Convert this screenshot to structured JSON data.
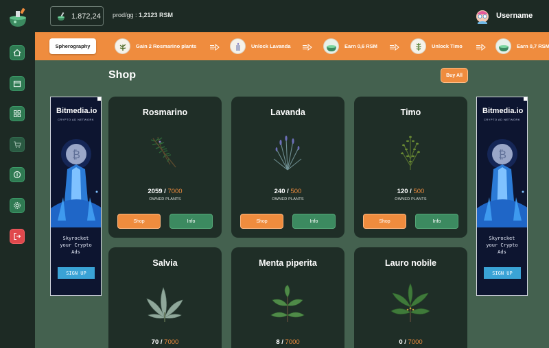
{
  "topbar": {
    "balance": "1.872,24",
    "prod_label": "prod/gg : ",
    "prod_value": "1,2123 RSM",
    "username": "Username"
  },
  "sidebar": {
    "items": [
      {
        "name": "home",
        "icon": "home-icon"
      },
      {
        "name": "calendar",
        "icon": "calendar-icon"
      },
      {
        "name": "grid",
        "icon": "grid-icon"
      },
      {
        "name": "cart",
        "icon": "cart-icon"
      },
      {
        "name": "coin",
        "icon": "coin-icon"
      },
      {
        "name": "settings",
        "icon": "gear-icon"
      },
      {
        "name": "logout",
        "icon": "logout-icon"
      }
    ]
  },
  "quests": {
    "spherography_label": "Spherography",
    "items": [
      {
        "label": "Gain 2 Rosmarino plants",
        "icon": "plant-icon"
      },
      {
        "label": "Unlock Lavanda",
        "icon": "plant-icon"
      },
      {
        "label": "Earn 0,6 RSM",
        "icon": "potion-icon"
      },
      {
        "label": "Unlock Timo",
        "icon": "plant-icon"
      },
      {
        "label": "Earn 0,7 RSM",
        "icon": "potion-icon"
      }
    ]
  },
  "shop": {
    "title": "Shop",
    "buy_all_label": "Buy All",
    "owned_label": "OWNED PLANTS",
    "shop_label": "Shop",
    "info_label": "Info",
    "cards": [
      {
        "name": "Rosmarino",
        "owned": "2059",
        "max": "7000"
      },
      {
        "name": "Lavanda",
        "owned": "240",
        "max": "500"
      },
      {
        "name": "Timo",
        "owned": "120",
        "max": "500"
      },
      {
        "name": "Salvia",
        "owned": "70",
        "max": "7000"
      },
      {
        "name": "Menta piperita",
        "owned": "8",
        "max": "7000"
      },
      {
        "name": "Lauro nobile",
        "owned": "0",
        "max": "7000"
      }
    ]
  },
  "ads": {
    "brand": "Bitmedia.io",
    "subtitle": "CRYPTO AD NETWORK",
    "text": "Skyrocket\nyour Crypto\nAds",
    "button": "SIGN UP"
  },
  "colors": {
    "accent": "#ef8c3e",
    "green": "#3c8a60",
    "panel": "#1f2e27",
    "main_bg": "#44614f"
  }
}
